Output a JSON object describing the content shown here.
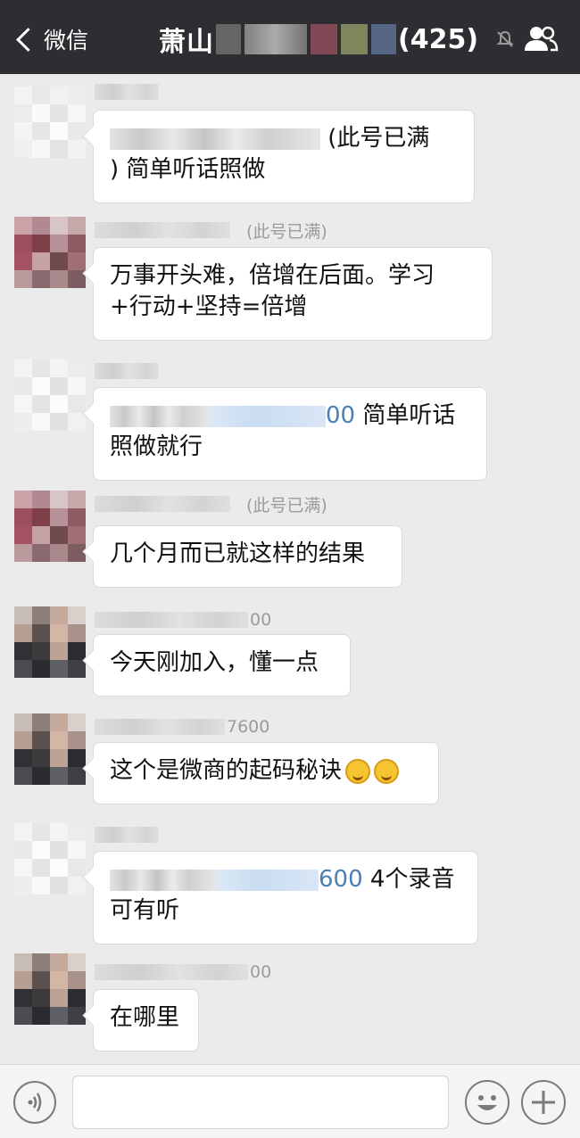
{
  "nav": {
    "back_label": "微信",
    "title": "萧山",
    "member_count": "(425)"
  },
  "messages": [
    {
      "id": "m1",
      "avatar": "light",
      "name_suffix": "",
      "text_before": "",
      "link": "",
      "text_after": "(此号已满\n) 简单听话照做"
    },
    {
      "id": "m2",
      "avatar": "red",
      "name_suffix": "(此号已满)",
      "text_before": "",
      "link": "",
      "text_after": "万事开头难，倍增在后面。学习+行动+坚持=倍增"
    },
    {
      "id": "m3",
      "avatar": "light",
      "name_suffix": "",
      "text_before": "",
      "link": "00",
      "text_after": " 简单听话照做就行"
    },
    {
      "id": "m4",
      "avatar": "red",
      "name_suffix": "(此号已满)",
      "text_before": "",
      "link": "",
      "text_after": "几个月而已就这样的结果"
    },
    {
      "id": "m5",
      "avatar": "dark",
      "name_suffix": "00",
      "text_before": "",
      "link": "",
      "text_after": "今天刚加入，懂一点"
    },
    {
      "id": "m6",
      "avatar": "dark",
      "name_suffix": "7600",
      "text_before": "",
      "link": "",
      "text_after": "这个是微商的起码秘诀"
    },
    {
      "id": "m7",
      "avatar": "light",
      "name_suffix": "",
      "text_before": "",
      "link": "600",
      "text_after": " 4个录音可有听"
    },
    {
      "id": "m8",
      "avatar": "dark",
      "name_suffix": "00",
      "text_before": "",
      "link": "",
      "text_after": "在哪里"
    }
  ],
  "emoji_in_m6": [
    "thinking-face-icon",
    "thinking-face-icon"
  ],
  "input": {
    "value": "",
    "placeholder": ""
  },
  "colors": {
    "nav_bg": "#2e2e32",
    "chat_bg": "#ebebeb",
    "link": "#4a7fb3"
  }
}
